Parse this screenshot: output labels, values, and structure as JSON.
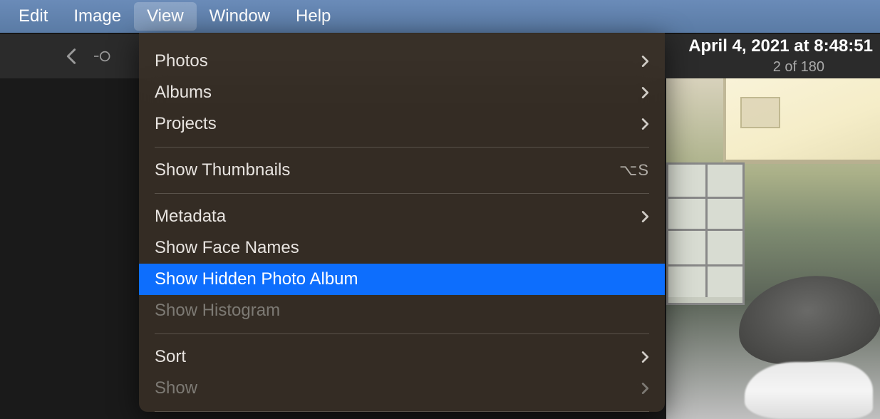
{
  "menubar": {
    "items": [
      {
        "label": "Edit",
        "active": false
      },
      {
        "label": "Image",
        "active": false
      },
      {
        "label": "View",
        "active": true
      },
      {
        "label": "Window",
        "active": false
      },
      {
        "label": "Help",
        "active": false
      }
    ]
  },
  "toolbar": {
    "date_text": "April 4, 2021 at 8:48:51",
    "counter_text": "2 of 180"
  },
  "view_menu": {
    "items": [
      {
        "label": "Photos",
        "submenu": true
      },
      {
        "label": "Albums",
        "submenu": true
      },
      {
        "label": "Projects",
        "submenu": true
      },
      {
        "separator": true
      },
      {
        "label": "Show Thumbnails",
        "shortcut": "⌥S"
      },
      {
        "separator": true
      },
      {
        "label": "Metadata",
        "submenu": true
      },
      {
        "label": "Show Face Names"
      },
      {
        "label": "Show Hidden Photo Album",
        "highlighted": true
      },
      {
        "label": "Show Histogram",
        "disabled": true
      },
      {
        "separator": true
      },
      {
        "label": "Sort",
        "submenu": true
      },
      {
        "label": "Show",
        "submenu": true,
        "disabled": true
      },
      {
        "separator": true
      }
    ]
  }
}
